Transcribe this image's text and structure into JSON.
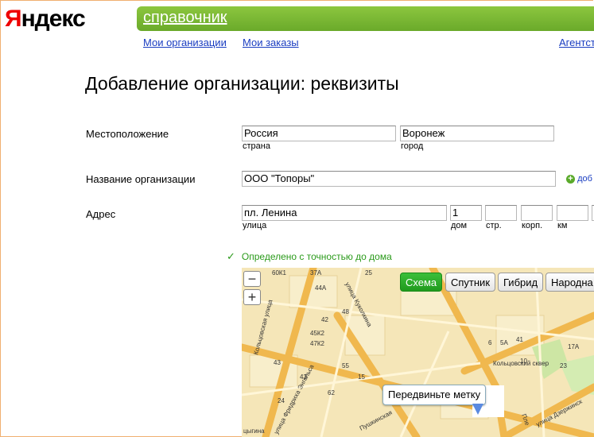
{
  "logo": {
    "first": "Я",
    "rest": "ндекс"
  },
  "section": {
    "title": "справочник"
  },
  "nav": {
    "my_orgs": "Мои организации",
    "my_orders": "Мои заказы",
    "agents": "Агентст"
  },
  "page": {
    "title": "Добавление организации: реквизиты"
  },
  "form": {
    "location_label": "Местоположение",
    "country_value": "Россия",
    "country_caption": "страна",
    "city_value": "Воронеж",
    "city_caption": "город",
    "org_name_label": "Название организации",
    "org_name_value": "ООО \"Топоры\"",
    "add_link": "доб",
    "address_label": "Адрес",
    "street_value": "пл. Ленина",
    "street_caption": "улица",
    "house_value": "1",
    "house_caption": "дом",
    "building_caption": "стр.",
    "korp_caption": "корп.",
    "km_caption": "км",
    "precision_check": "✓",
    "precision_note": "Определено с точностью до дома"
  },
  "map": {
    "buttons": {
      "scheme": "Схема",
      "satellite": "Спутник",
      "hybrid": "Гибрид",
      "people": "Народна"
    },
    "zoom_out": "−",
    "zoom_in": "+",
    "tooltip": "Передвиньте метку",
    "labels": {
      "l1": "60К1",
      "l2": "37А",
      "l3": "25",
      "l4": "44А",
      "l5": "42",
      "l6": "48",
      "l7": "45К2",
      "l8": "47К2",
      "l9": "43",
      "l10": "55",
      "l11": "43",
      "l12": "15",
      "l13": "62",
      "l14": "24",
      "l15": "6",
      "l16": "5А",
      "l17": "41",
      "l18": "17А",
      "l19": "10",
      "l20": "23",
      "park": "Кольцовский сквер",
      "st_koltsovskaya": "Кольцовская улица",
      "st_kukolkina": "улица Куколкина",
      "st_engels": "улица Фридриха Энгельса",
      "st_pushkinskaya": "Пушкинская",
      "st_plekhanovskaya": "Пле",
      "st_dzerzhinskogo": "улица Дзержинск",
      "st_tsygina": "цыгина"
    }
  },
  "colors": {
    "accent_green": "#6aaa2a",
    "link_blue": "#1a3dc1",
    "logo_red": "#e00000",
    "map_road": "#f0b84e"
  }
}
